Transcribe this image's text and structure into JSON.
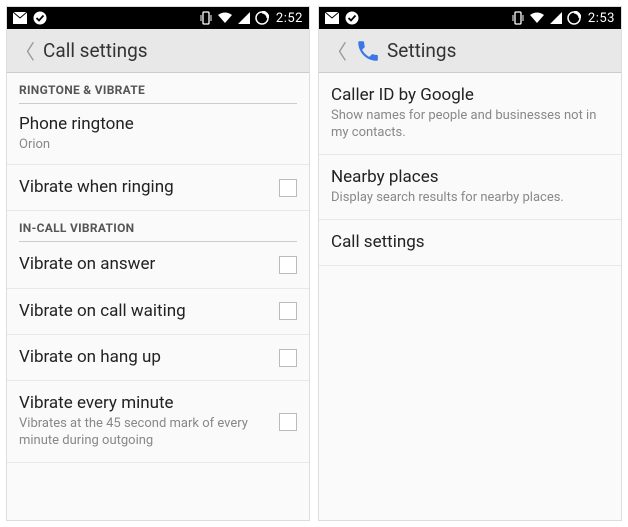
{
  "left": {
    "status": {
      "time": "2:52"
    },
    "actionbar": {
      "title": "Call settings"
    },
    "sections": [
      {
        "header": "RINGTONE & VIBRATE",
        "items": [
          {
            "title": "Phone ringtone",
            "summary": "Orion",
            "checkbox": false,
            "has_checkbox": false
          },
          {
            "title": "Vibrate when ringing",
            "summary": "",
            "checkbox": false,
            "has_checkbox": true
          }
        ]
      },
      {
        "header": "IN-CALL VIBRATION",
        "items": [
          {
            "title": "Vibrate on answer",
            "summary": "",
            "checkbox": false,
            "has_checkbox": true
          },
          {
            "title": "Vibrate on call waiting",
            "summary": "",
            "checkbox": false,
            "has_checkbox": true
          },
          {
            "title": "Vibrate on hang up",
            "summary": "",
            "checkbox": false,
            "has_checkbox": true
          },
          {
            "title": "Vibrate every minute",
            "summary": "Vibrates at the 45 second mark of every minute during outgoing",
            "checkbox": false,
            "has_checkbox": true
          }
        ]
      }
    ]
  },
  "right": {
    "status": {
      "time": "2:53"
    },
    "actionbar": {
      "title": "Settings"
    },
    "items": [
      {
        "title": "Caller ID by Google",
        "summary": "Show names for people and businesses not in my contacts."
      },
      {
        "title": "Nearby places",
        "summary": "Display search results for nearby places."
      },
      {
        "title": "Call settings",
        "summary": ""
      }
    ]
  }
}
